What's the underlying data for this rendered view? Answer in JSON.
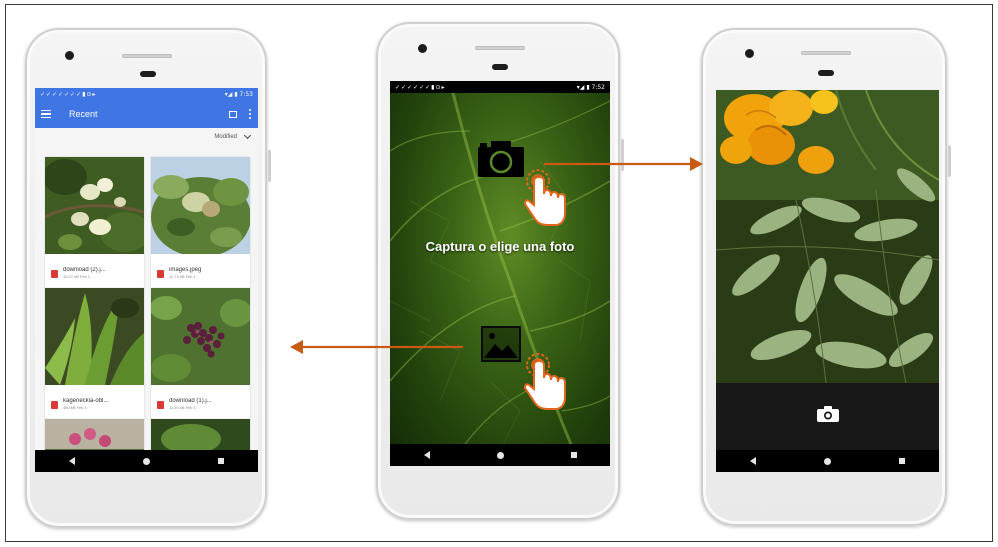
{
  "phone1": {
    "status_left": "✓✓✓✓✓✓✓▮⊙▸",
    "status_right": "▾◢ ▮ 7:53",
    "appbar_title": "Recent",
    "sort_label": "Modified",
    "files": [
      {
        "name": "download (2).j...",
        "meta": "10.27 kB Feb 1"
      },
      {
        "name": "images.jpeg",
        "meta": "11.74 kB Feb 1"
      },
      {
        "name": "kageneckia-obl...",
        "meta": "480 kB Feb 1"
      },
      {
        "name": "download (1).j...",
        "meta": "11.20 kB Feb 1"
      }
    ]
  },
  "phone2": {
    "status_left": "✓✓✓✓✓✓▮⊙▸",
    "status_right": "▾◢ ▮ 7:52",
    "capture_text": "Captura o elige una foto"
  },
  "colors": {
    "arrow": "#c85a14",
    "appbar": "#3f76e4"
  },
  "icons": [
    "camera-icon",
    "image-icon",
    "hand-pointer-icon",
    "menu-icon",
    "grid-view-icon",
    "more-icon",
    "chevron-down-icon",
    "back-icon",
    "home-icon",
    "recent-apps-icon",
    "shutter-icon"
  ]
}
